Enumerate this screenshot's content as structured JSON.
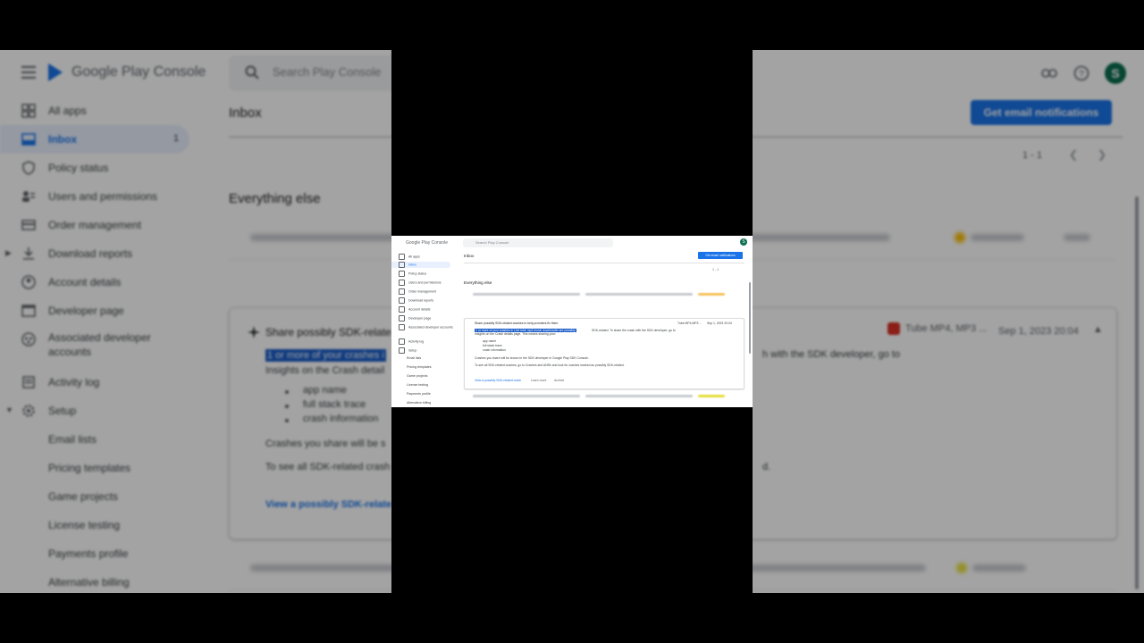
{
  "app": {
    "product_name": "Google Play Console",
    "search_placeholder": "Search Play Console",
    "avatar_letter": "S",
    "brand_color": "#1a73e8"
  },
  "nav": {
    "items": [
      {
        "label": "All apps",
        "icon": "grid-icon"
      },
      {
        "label": "Inbox",
        "icon": "inbox-icon",
        "badge": "1",
        "active": true
      },
      {
        "label": "Policy status",
        "icon": "shield-check-icon"
      },
      {
        "label": "Users and permissions",
        "icon": "users-icon"
      },
      {
        "label": "Order management",
        "icon": "credit-card-icon"
      },
      {
        "label": "Download reports",
        "icon": "download-icon"
      },
      {
        "label": "Account details",
        "icon": "account-circle-icon"
      },
      {
        "label": "Developer page",
        "icon": "web-icon"
      },
      {
        "label": "Associated developer accounts",
        "icon": "linked-accounts-icon"
      },
      {
        "label": "Activity log",
        "icon": "history-icon"
      },
      {
        "label": "Setup",
        "icon": "gear-icon"
      },
      {
        "label": "Email lists"
      },
      {
        "label": "Pricing templates"
      },
      {
        "label": "Game projects"
      },
      {
        "label": "License testing"
      },
      {
        "label": "Payments profile"
      },
      {
        "label": "Alternative billing"
      }
    ]
  },
  "main": {
    "page_title": "Inbox",
    "cta_label": "Get email notifications",
    "pager_text": "1 - 1",
    "section_title": "Everything else",
    "card": {
      "title": "Share possibly SDK-relate",
      "app_name": "Tube MP4, MP3 ...",
      "date": "Sep 1, 2023 20:04",
      "highlighted": "1 or more of your crashes i",
      "tail_1": "h with the SDK developer, go to",
      "sub": "Insights on the Crash detail",
      "bullets": [
        "app name",
        "full stack trace",
        "crash information"
      ],
      "line_2": "Crashes you share will be s",
      "line_3": "To see all SDK-related crash",
      "tail_3": "d.",
      "link": "View a possibly SDK-relate"
    }
  },
  "mini": {
    "logo": "Google Play Console",
    "search_placeholder": "Search Play Console",
    "avatar": "S",
    "nav": [
      "All apps",
      "Inbox",
      "Policy status",
      "Users and permissions",
      "Order management",
      "Download reports",
      "Account details",
      "Developer page",
      "Associated developer accounts",
      "Activity log",
      "Setup",
      "Email lists",
      "Pricing templates",
      "Game projects",
      "License testing",
      "Payments profile",
      "Alternative billing"
    ],
    "page_title": "Inbox",
    "cta": "Get email notifications",
    "pager": "1 - 1",
    "section": "Everything else",
    "card_title": "Share possibly SDK-related crashes to help providers fix them",
    "app": "Tube MP4,MP3 ...",
    "date": "Sep 1, 2023 20:04",
    "highlight": "1 or more of your crashes in Live tube mp4 music downloader are possibly",
    "rest": "SDK-related. To share the crash with the SDK developer, go to",
    "line_b": "Insights on the Crash details page. This means sharing your:",
    "bullets": [
      "app name",
      "full stack trace",
      "crash information"
    ],
    "line_c": "Crashes you share will be shown in the SDK developer in Google Play SDK Console.",
    "line_d": "To see all SDK-related crashes, go to Crashes and ANRs and look for crashes marked as possibly SDK-related.",
    "link": "View a possibly SDK-related crash",
    "learn": "Learn more",
    "archive": "Archive"
  }
}
